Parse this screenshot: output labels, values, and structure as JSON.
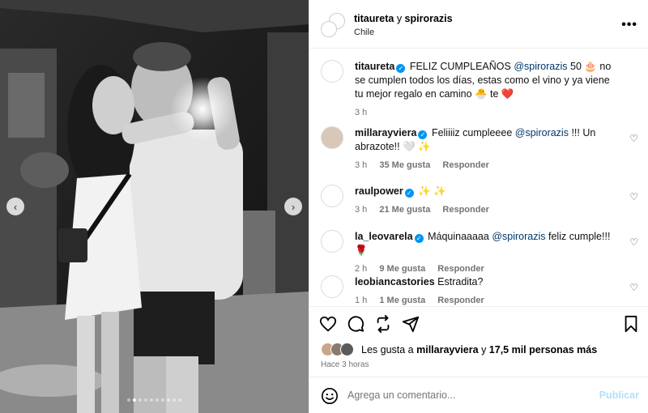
{
  "header": {
    "user1": "titaureta",
    "conj": "y",
    "user2": "spirorazis",
    "location": "Chile",
    "more": "•••"
  },
  "caption": {
    "user": "titaureta",
    "text_a": "FELIZ CUMPLEAÑOS",
    "mention": "@spirorazis",
    "text_b": "50 🎂 no se cumplen todos los días, estas como el vino y ya viene tu mejor regalo en camino 🐣 te ❤️",
    "time": "3 h"
  },
  "comments": [
    {
      "user": "millarayviera",
      "verified": true,
      "text_a": "Feliiiiz cumpleeee",
      "mention": "@spirorazis",
      "text_b": "!!! Un abrazote!! 🤍 ✨",
      "time": "3 h",
      "likes": "35 Me gusta",
      "reply": "Responder"
    },
    {
      "user": "raulpower",
      "verified": true,
      "text_a": "✨ ✨",
      "mention": "",
      "text_b": "",
      "time": "3 h",
      "likes": "21 Me gusta",
      "reply": "Responder"
    },
    {
      "user": "la_leovarela",
      "verified": true,
      "text_a": "Máquinaaaaa",
      "mention": "@spirorazis",
      "text_b": "feliz cumple!!! 🌹",
      "time": "2 h",
      "likes": "9 Me gusta",
      "reply": "Responder"
    },
    {
      "user": "leobiancastories",
      "verified": false,
      "text_a": "Estradita?",
      "mention": "",
      "text_b": "",
      "time": "1 h",
      "likes": "1 Me gusta",
      "reply": "Responder"
    }
  ],
  "likes": {
    "prefix": "Les gusta a",
    "user": "millarayviera",
    "middle": "y",
    "count": "17,5 mil personas más"
  },
  "posted": "Hace 3 horas",
  "add_comment": {
    "placeholder": "Agrega un comentario...",
    "post_label": "Publicar"
  },
  "icons": {
    "like": "heart-icon",
    "comment": "comment-icon",
    "share": "repost-icon",
    "send": "send-icon",
    "save": "bookmark-icon",
    "emoji": "smile-icon"
  },
  "colors": {
    "accent": "#0095f6",
    "link": "#00376b",
    "muted": "#737373",
    "post_disabled": "#b2dffc"
  }
}
